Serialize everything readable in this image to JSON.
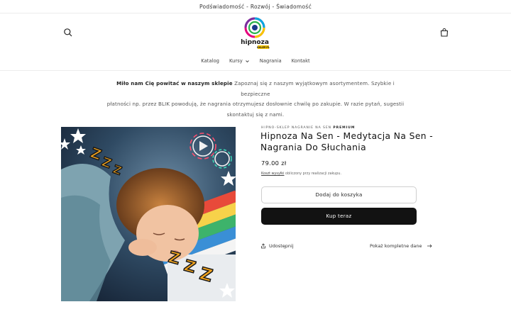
{
  "announcement": {
    "text": "Podświadomość - Rozwój - Świadomość"
  },
  "header": {
    "logo": {
      "name": "hipnoza",
      "sub": "SKLEP.PL"
    },
    "nav": [
      {
        "label": "Katalog"
      },
      {
        "label": "Kursy",
        "has_dropdown": true
      },
      {
        "label": "Nagrania"
      },
      {
        "label": "Kontakt"
      }
    ]
  },
  "welcome": {
    "bold": "Miło nam Cię powitać w naszym sklepie",
    "line1_rest": " Zapoznaj się z naszym wyjątkowym asortymentem. Szybkie i bezpieczne",
    "line2": "płatności np. przez BLIK powodują, że nagrania otrzymujesz dosłownie chwilę po zakupie. W razie pytań, sugestii",
    "line3": "skontaktuj się z nami."
  },
  "product": {
    "vendor_prefix": "HIPNO-SKLEP NAGRANIE NA SEN",
    "vendor_badge": "PREMIUM",
    "title": "Hipnoza Na Sen - Medytacja Na Sen - Nagrania Do Słuchania",
    "price": "79.00 zł",
    "shipping_link": "Koszt wysyłki",
    "shipping_rest": " obliczony przy realizacji zakupu.",
    "add_to_cart": "Dodaj do koszyka",
    "buy_now": "Kup teraz",
    "share": "Udostępnij",
    "full_details": "Pokaż kompletne dane"
  },
  "colors": {
    "primary": "#121212",
    "border": "#cfcfcf",
    "zzz": "#f4a51c"
  }
}
